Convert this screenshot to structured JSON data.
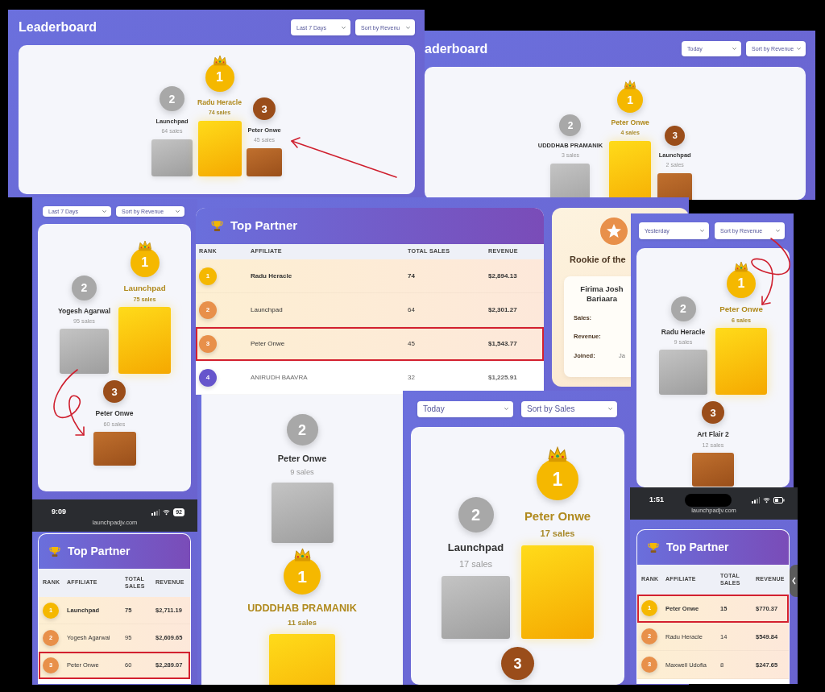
{
  "panels": [
    {
      "kind": "leaderboard",
      "title": "Leaderboard",
      "filters": [
        "Last 7 Days",
        "Sort by Revenu"
      ],
      "podium": [
        {
          "color": "#a8a8a8",
          "rank": "2",
          "name": "Launchpad",
          "sales": "64 sales"
        },
        {
          "color": "#f5b800",
          "rank": "1",
          "name": "Radu Heracle",
          "sales": "74 sales"
        },
        {
          "color": "#9a4d1a",
          "rank": "3",
          "name": "Peter Onwe",
          "sales": "45 sales"
        }
      ]
    },
    {
      "kind": "leaderboard",
      "title": "aderboard",
      "filters": [
        "Today",
        "Sort by Revenue"
      ],
      "podium": [
        {
          "color": "#a8a8a8",
          "rank": "2",
          "name": "UDDDHAB PRAMANIK",
          "sales": "3 sales"
        },
        {
          "color": "#f5b800",
          "rank": "1",
          "name": "Peter Onwe",
          "sales": "4 sales"
        },
        {
          "color": "#9a4d1a",
          "rank": "3",
          "name": "Launchpad",
          "sales": "2 sales"
        }
      ]
    },
    {
      "kind": "podium",
      "filters": [
        "Last 7 Days",
        "Sort by Revenue"
      ],
      "podium": [
        {
          "color": "#a8a8a8",
          "rank": "2",
          "name": "Yogesh Agarwal",
          "sales": "95 sales"
        },
        {
          "color": "#f5b800",
          "rank": "1",
          "name": "Launchpad",
          "sales": "75 sales"
        },
        {
          "color": "#9a4d1a",
          "rank": "3",
          "name": "Peter Onwe",
          "sales": "60 sales"
        }
      ]
    },
    {
      "kind": "table",
      "title": "Top Partner",
      "columns": [
        "RANK",
        "AFFILIATE",
        "TOTAL SALES",
        "REVENUE"
      ],
      "rows": [
        {
          "rank": "1",
          "color": "#f5b800",
          "affiliate": "Radu Heracle",
          "total_sales": "74",
          "revenue": "$2,894.13",
          "highlighted": false
        },
        {
          "rank": "2",
          "color": "#e8904a",
          "affiliate": "Launchpad",
          "total_sales": "64",
          "revenue": "$2,301.27",
          "highlighted": false
        },
        {
          "rank": "3",
          "color": "#e8904a",
          "affiliate": "Peter Onwe",
          "total_sales": "45",
          "revenue": "$1,543.77",
          "highlighted": true
        },
        {
          "rank": "4",
          "color": "#6655cc",
          "affiliate": "ANIRUDH BAAVRA",
          "total_sales": "32",
          "revenue": "$1,225.91",
          "highlighted": false
        }
      ]
    },
    {
      "kind": "rookie",
      "title": "Rookie of the",
      "name_lines": [
        "Firima Josh",
        "Bariaara"
      ],
      "fields": [
        {
          "label": "Sales:"
        },
        {
          "label": "Revenue:"
        },
        {
          "label": "Joined:",
          "value": "Ja"
        }
      ]
    },
    {
      "kind": "podium",
      "filters": [
        "Yesterday",
        "Sort by Revenue"
      ],
      "podium": [
        {
          "color": "#a8a8a8",
          "rank": "2",
          "name": "Radu Heracle",
          "sales": "9 sales"
        },
        {
          "color": "#f5b800",
          "rank": "1",
          "name": "Peter Onwe",
          "sales": "6 sales"
        },
        {
          "color": "#9a4d1a",
          "rank": "3",
          "name": "Art Flair 2",
          "sales": "12 sales"
        }
      ]
    },
    {
      "kind": "phone_table",
      "status": {
        "time": "9:09",
        "battery": "92"
      },
      "url": "launchpadjv.com",
      "title": "Top Partner",
      "columns": [
        "RANK",
        "AFFILIATE",
        "TOTAL SALES",
        "REVENUE"
      ],
      "rows": [
        {
          "rank": "1",
          "color": "#f5b800",
          "affiliate": "Launchpad",
          "total_sales": "75",
          "revenue": "$2,711.19",
          "highlighted": false
        },
        {
          "rank": "2",
          "color": "#e8904a",
          "affiliate": "Yogesh Agarwal",
          "total_sales": "95",
          "revenue": "$2,609.65",
          "highlighted": false
        },
        {
          "rank": "3",
          "color": "#e8904a",
          "affiliate": "Peter Onwe",
          "total_sales": "60",
          "revenue": "$2,289.07",
          "highlighted": true
        }
      ]
    },
    {
      "kind": "stacked_podium",
      "podium": [
        {
          "color": "#a8a8a8",
          "rank": "2",
          "name": "Peter Onwe",
          "sales": "9 sales"
        },
        {
          "color": "#f5b800",
          "rank": "1",
          "name": "UDDDHAB PRAMANIK",
          "sales": "11 sales"
        }
      ]
    },
    {
      "kind": "podium",
      "filters": [
        "Today",
        "Sort by Sales"
      ],
      "podium": [
        {
          "color": "#a8a8a8",
          "rank": "2",
          "name": "Launchpad",
          "sales": "17 sales"
        },
        {
          "color": "#f5b800",
          "rank": "1",
          "name": "Peter Onwe",
          "sales": "17 sales"
        },
        {
          "color": "#9a4d1a",
          "rank": "3"
        }
      ]
    },
    {
      "kind": "phone_table",
      "status": {
        "time": "1:51"
      },
      "url": "launchpadjv.com",
      "title": "Top Partner",
      "columns": [
        "RANK",
        "AFFILIATE",
        "TOTAL SALES",
        "REVENUE"
      ],
      "rows": [
        {
          "rank": "1",
          "color": "#f5b800",
          "affiliate": "Peter Onwe",
          "total_sales": "15",
          "revenue": "$770.37",
          "highlighted": true
        },
        {
          "rank": "2",
          "color": "#e8904a",
          "affiliate": "Radu Heracle",
          "total_sales": "14",
          "revenue": "$549.84",
          "highlighted": false
        },
        {
          "rank": "3",
          "color": "#e8904a",
          "affiliate": "Maxwell Udofia",
          "total_sales": "8",
          "revenue": "$247.65",
          "highlighted": false
        }
      ]
    }
  ]
}
